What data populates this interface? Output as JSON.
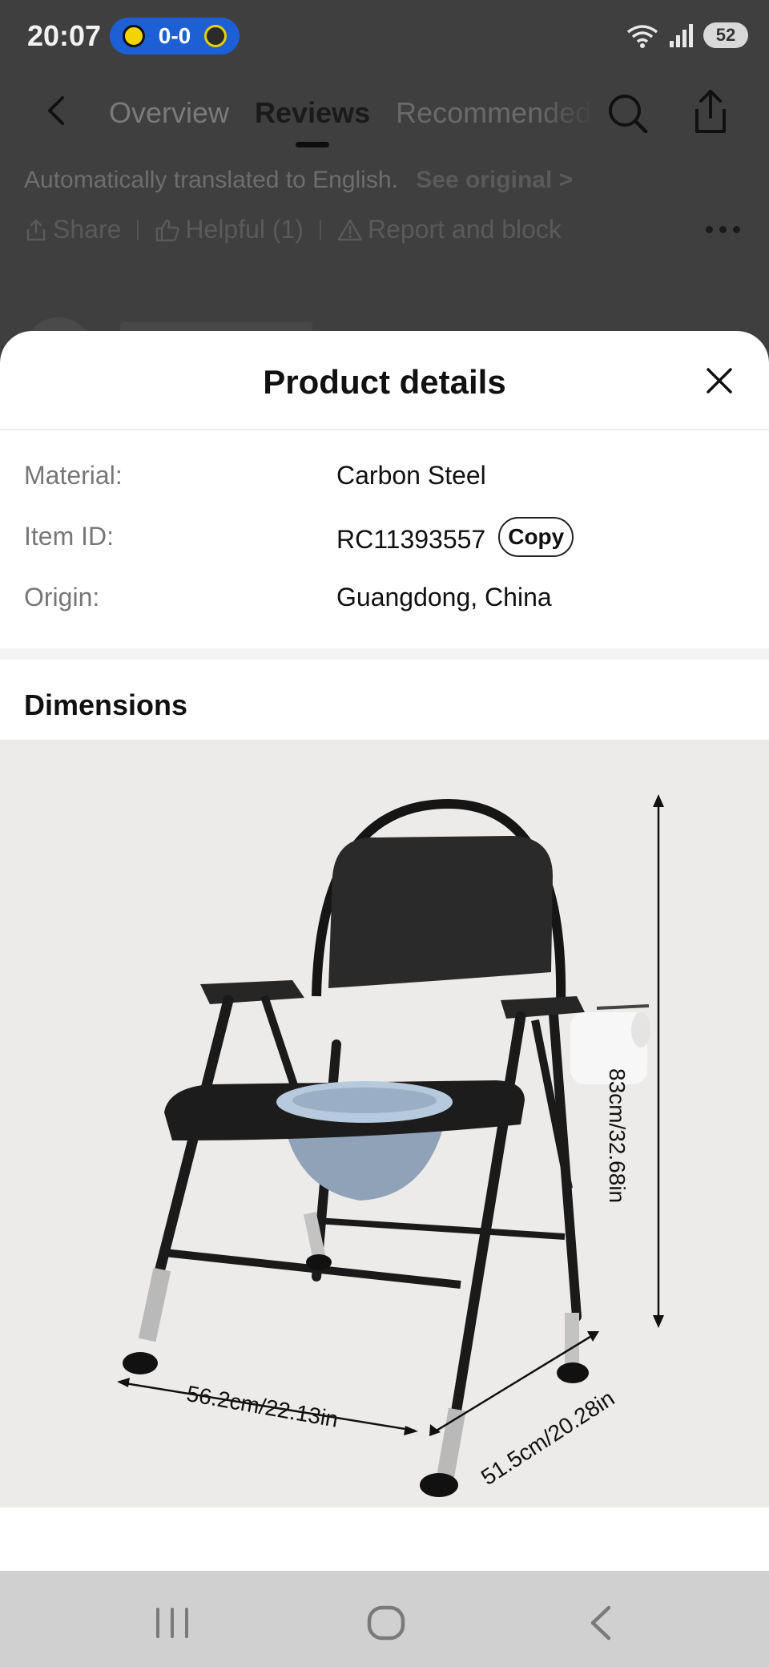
{
  "status_bar": {
    "time": "20:07",
    "score": "0-0",
    "battery": "52"
  },
  "nav": {
    "tabs": [
      {
        "label": "Overview"
      },
      {
        "label": "Reviews"
      },
      {
        "label": "Recommended"
      }
    ],
    "active_tab": "Reviews"
  },
  "review": {
    "translated_note": "Automatically translated to English.",
    "see_original": "See original >",
    "share": "Share",
    "helpful": "Helpful (1)",
    "report": "Report and block"
  },
  "sheet": {
    "title": "Product details",
    "details": [
      {
        "label": "Material:",
        "value": "Carbon Steel"
      },
      {
        "label": "Item ID:",
        "value": "RC11393557"
      },
      {
        "label": "Origin:",
        "value": "Guangdong, China"
      }
    ],
    "copy_label": "Copy",
    "dimensions_title": "Dimensions",
    "dimension_labels": {
      "height": "83cm/32.68in",
      "width": "56.2cm/22.13in",
      "depth": "51.5cm/20.28in"
    }
  },
  "colors": {
    "score_pill": "#1d5fd4",
    "overlay": "#3f3f3f",
    "sheet_bg": "#ffffff",
    "image_bg": "#ecebea"
  }
}
